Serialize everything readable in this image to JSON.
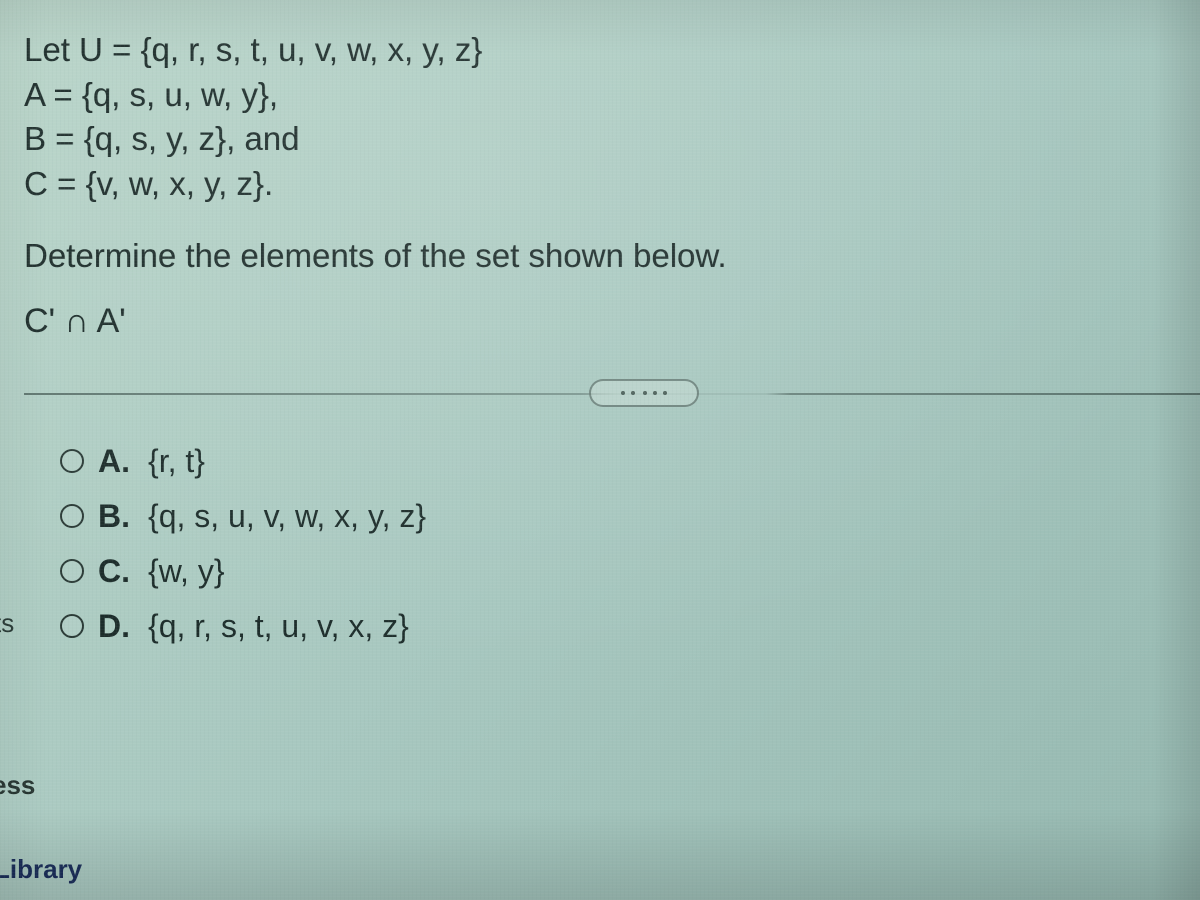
{
  "problem": {
    "line1": "Let U = {q, r, s, t, u, v, w, x, y, z}",
    "line2": "A = {q, s, u, w, y},",
    "line3": "B = {q, s, y, z}, and",
    "line4": "C = {v, w, x, y, z}.",
    "instruction": "Determine the elements of the set shown below.",
    "expression": "C' ∩ A'"
  },
  "options": {
    "a": {
      "letter": "A.",
      "text": "{r, t}"
    },
    "b": {
      "letter": "B.",
      "text": "{q, s, u, v, w, x, y, z}"
    },
    "c": {
      "letter": "C.",
      "text": "{w, y}"
    },
    "d": {
      "letter": "D.",
      "text": "{q, r, s, t, u, v, x, z}"
    }
  },
  "side": {
    "ts": "ts",
    "ess": "ess",
    "library": "Library"
  }
}
